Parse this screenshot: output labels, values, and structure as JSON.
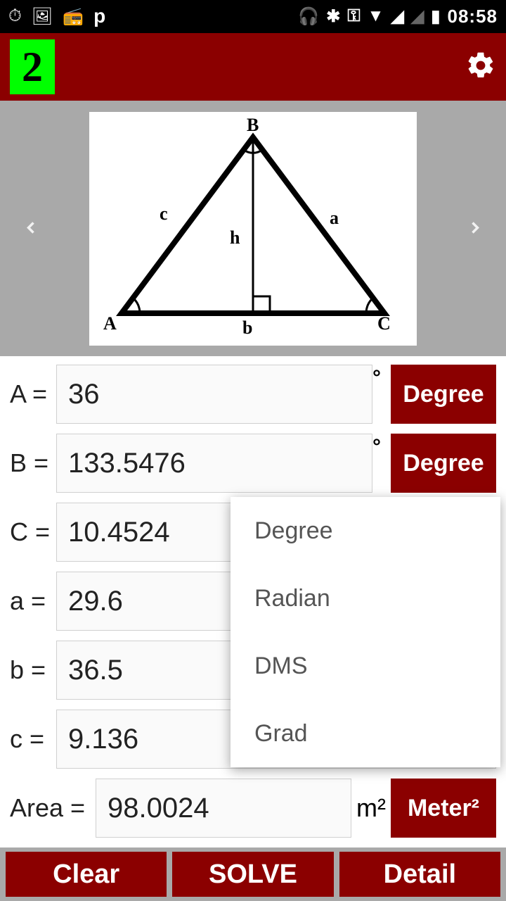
{
  "status": {
    "time": "08:58"
  },
  "toolbar": {
    "mode": "2"
  },
  "diagram": {
    "labels": {
      "A": "A",
      "B": "B",
      "C": "C",
      "a": "a",
      "b": "b",
      "c": "c",
      "h": "h"
    }
  },
  "fields": {
    "A": {
      "label": "A =",
      "value": "36",
      "symbol": "°",
      "unit": "Degree"
    },
    "B": {
      "label": "B =",
      "value": "133.5476",
      "symbol": "°",
      "unit": "Degree"
    },
    "C": {
      "label": "C =",
      "value": "10.4524"
    },
    "a": {
      "label": "a =",
      "value": "29.6"
    },
    "b": {
      "label": "b =",
      "value": "36.5"
    },
    "c": {
      "label": "c =",
      "value": "9.136"
    },
    "area": {
      "label": "Area =",
      "value": "98.0024",
      "symbol": "m²",
      "unit": "Meter²"
    }
  },
  "dropdown": {
    "items": [
      "Degree",
      "Radian",
      "DMS",
      "Grad"
    ]
  },
  "buttons": {
    "clear": "Clear",
    "solve": "SOLVE",
    "detail": "Detail"
  }
}
